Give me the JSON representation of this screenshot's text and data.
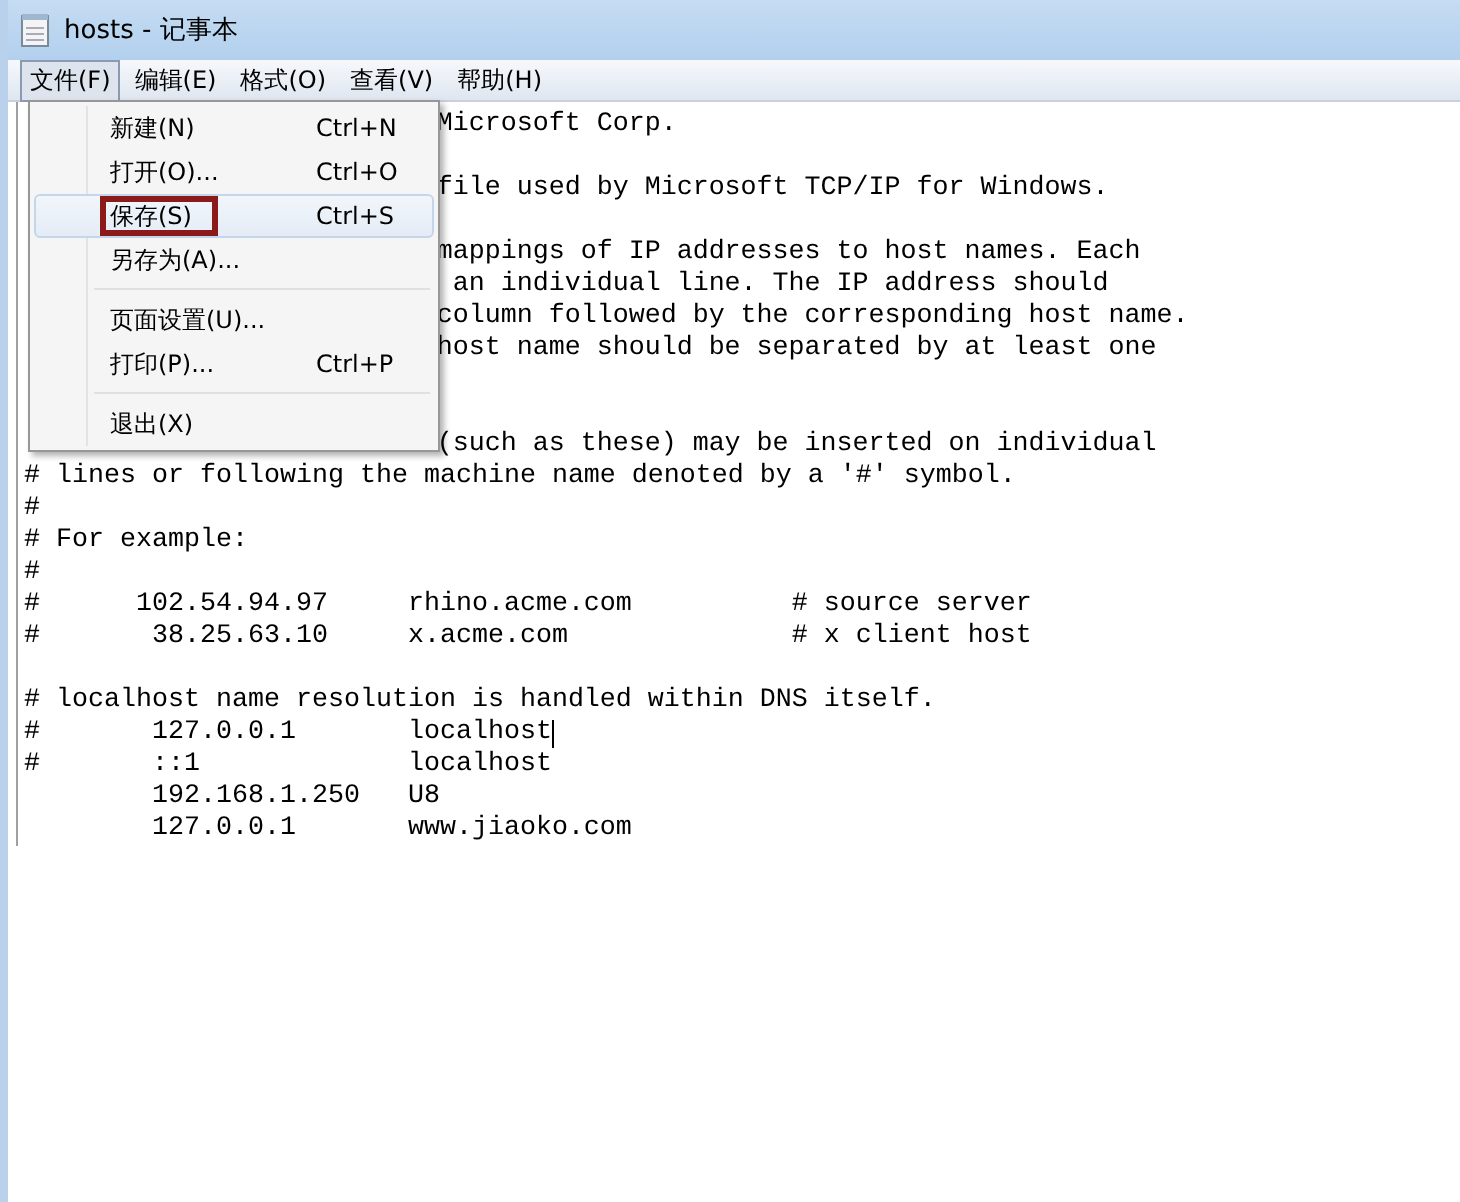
{
  "window": {
    "title": "hosts - 记事本"
  },
  "menu_bar": [
    {
      "label": "文件(F)",
      "selected": true
    },
    {
      "label": "编辑(E)",
      "selected": false
    },
    {
      "label": "格式(O)",
      "selected": false
    },
    {
      "label": "查看(V)",
      "selected": false
    },
    {
      "label": "帮助(H)",
      "selected": false
    }
  ],
  "file_menu": [
    {
      "kind": "item",
      "label": "新建(N)",
      "shortcut": "Ctrl+N",
      "selected": false,
      "outlined": false
    },
    {
      "kind": "item",
      "label": "打开(O)...",
      "shortcut": "Ctrl+O",
      "selected": false,
      "outlined": false
    },
    {
      "kind": "item",
      "label": "保存(S)",
      "shortcut": "Ctrl+S",
      "selected": true,
      "outlined": true
    },
    {
      "kind": "item",
      "label": "另存为(A)...",
      "selected": false,
      "outlined": false
    },
    {
      "kind": "separator"
    },
    {
      "kind": "item",
      "label": "页面设置(U)...",
      "selected": false,
      "outlined": false
    },
    {
      "kind": "item",
      "label": "打印(P)...",
      "shortcut": "Ctrl+P",
      "selected": false,
      "outlined": false
    },
    {
      "kind": "separator"
    },
    {
      "kind": "item",
      "label": "退出(X)",
      "selected": false,
      "outlined": false
    }
  ],
  "editor_lines": [
    {
      "kind": "partial",
      "text": "Microsoft Corp.",
      "cursor": false
    },
    {
      "kind": "blank"
    },
    {
      "kind": "partial",
      "text": "file used by Microsoft TCP/IP for Windows.",
      "cursor": false
    },
    {
      "kind": "blank"
    },
    {
      "kind": "partial",
      "text": "mappings of IP addresses to host names. Each",
      "cursor": false
    },
    {
      "kind": "partial",
      "text": " an individual line. The IP address should",
      "cursor": false
    },
    {
      "kind": "partial",
      "text": "column followed by the corresponding host name.",
      "cursor": false
    },
    {
      "kind": "partial",
      "text": "host name should be separated by at least one",
      "cursor": false
    },
    {
      "kind": "blank"
    },
    {
      "kind": "blank"
    },
    {
      "kind": "partial",
      "text": "(such as these) may be inserted on individual",
      "cursor": false
    },
    {
      "kind": "line",
      "text": "# lines or following the machine name denoted by a '#' symbol.",
      "cursor": false
    },
    {
      "kind": "line",
      "text": "#",
      "cursor": false
    },
    {
      "kind": "line",
      "text": "# For example:",
      "cursor": false
    },
    {
      "kind": "line",
      "text": "#",
      "cursor": false
    },
    {
      "kind": "line",
      "text": "#      102.54.94.97     rhino.acme.com          # source server",
      "cursor": false
    },
    {
      "kind": "line",
      "text": "#       38.25.63.10     x.acme.com              # x client host",
      "cursor": false
    },
    {
      "kind": "blank"
    },
    {
      "kind": "line",
      "text": "# localhost name resolution is handled within DNS itself.",
      "cursor": false
    },
    {
      "kind": "line",
      "text": "#       127.0.0.1       localhost",
      "cursor": true
    },
    {
      "kind": "line",
      "text": "#       ::1             localhost",
      "cursor": false
    },
    {
      "kind": "line",
      "text": "        192.168.1.250   U8",
      "cursor": false
    },
    {
      "kind": "line",
      "text": "        127.0.0.1       www.jiaoko.com",
      "cursor": false
    }
  ]
}
